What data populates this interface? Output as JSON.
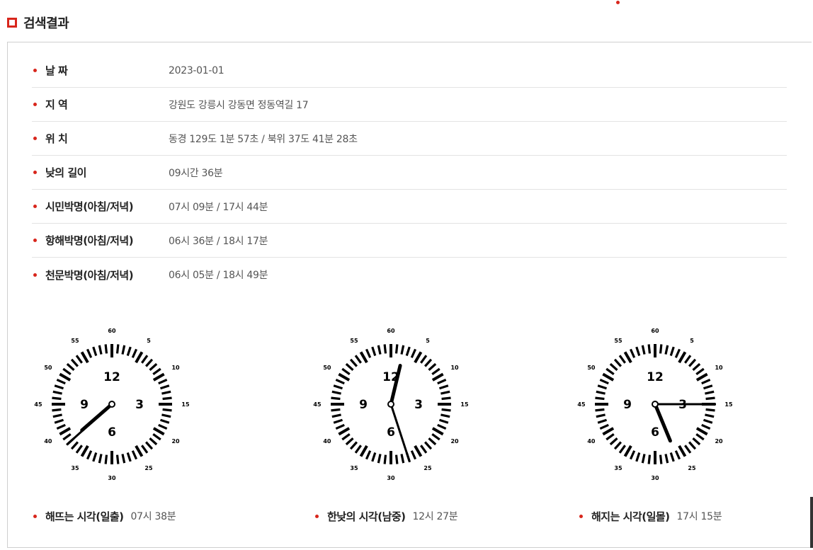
{
  "section": {
    "title": "검색결과"
  },
  "info": [
    {
      "label": "날 짜",
      "value": "2023-01-01"
    },
    {
      "label": "지 역",
      "value": "강원도 강릉시 강동면 정동역길 17"
    },
    {
      "label": "위 치",
      "value": "동경 129도 1분 57초 / 북위 37도 41분 28초"
    },
    {
      "label": "낮의 길이",
      "value": "09시간 36분"
    },
    {
      "label": "시민박명(아침/저녁)",
      "value": "07시 09분 / 17시 44분"
    },
    {
      "label": "항해박명(아침/저녁)",
      "value": "06시 36분 / 18시 17분"
    },
    {
      "label": "천문박명(아침/저녁)",
      "value": "06시 05분 / 18시 49분"
    }
  ],
  "clock_face": {
    "hour_numbers": [
      "12",
      "3",
      "6",
      "9"
    ],
    "minute_numbers": [
      "60",
      "5",
      "10",
      "15",
      "20",
      "25",
      "30",
      "35",
      "40",
      "45",
      "50",
      "55"
    ]
  },
  "clocks": [
    {
      "label": "해뜨는 시각(일출)",
      "value": "07시 38분",
      "hour": 7,
      "minute": 38
    },
    {
      "label": "한낮의 시각(남중)",
      "value": "12시 27분",
      "hour": 12,
      "minute": 27
    },
    {
      "label": "해지는 시각(일몰)",
      "value": "17시 15분",
      "hour": 17,
      "minute": 15
    }
  ]
}
